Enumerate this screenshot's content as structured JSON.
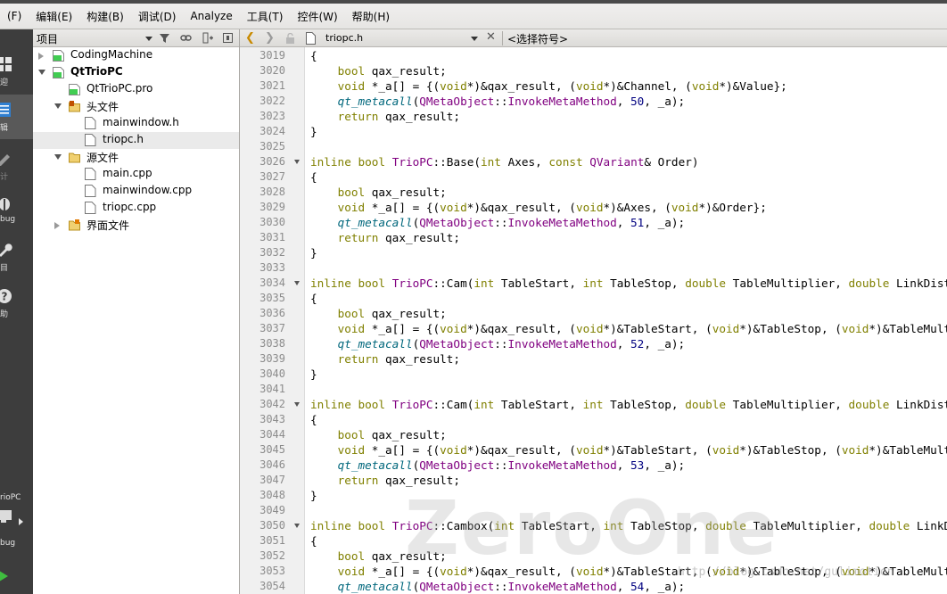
{
  "menu": [
    "(F)",
    "编辑(E)",
    "构建(B)",
    "调试(D)",
    "Analyze",
    "工具(T)",
    "控件(W)",
    "帮助(H)"
  ],
  "modes": [
    {
      "label": "迎",
      "icon": "grid-icon"
    },
    {
      "label": "辑",
      "icon": "edit-icon"
    },
    {
      "label": "计",
      "icon": "pencil-icon"
    },
    {
      "label": "bug",
      "icon": "debug-icon"
    },
    {
      "label": "目",
      "icon": "wrench-icon"
    },
    {
      "label": "助",
      "icon": "help-icon"
    }
  ],
  "kit": {
    "label": "rioPC",
    "sublabel": "bug"
  },
  "project_panel": {
    "title": "项目"
  },
  "tree": [
    {
      "label": "CodingMachine",
      "bold": false,
      "level": 0,
      "arrow": "right",
      "icon": "qt-project-icon",
      "selected": false
    },
    {
      "label": "QtTrioPC",
      "bold": true,
      "level": 0,
      "arrow": "down",
      "icon": "qt-project-icon",
      "selected": false
    },
    {
      "label": "QtTrioPC.pro",
      "bold": false,
      "level": 1,
      "arrow": "none",
      "icon": "qt-project-icon",
      "selected": false
    },
    {
      "label": "头文件",
      "bold": false,
      "level": 1,
      "arrow": "down",
      "icon": "header-folder-icon",
      "selected": false
    },
    {
      "label": "mainwindow.h",
      "bold": false,
      "level": 2,
      "arrow": "none",
      "icon": "file-icon",
      "selected": false
    },
    {
      "label": "triopc.h",
      "bold": false,
      "level": 2,
      "arrow": "none",
      "icon": "file-icon",
      "selected": true
    },
    {
      "label": "源文件",
      "bold": false,
      "level": 1,
      "arrow": "down",
      "icon": "source-folder-icon",
      "selected": false
    },
    {
      "label": "main.cpp",
      "bold": false,
      "level": 2,
      "arrow": "none",
      "icon": "file-icon",
      "selected": false
    },
    {
      "label": "mainwindow.cpp",
      "bold": false,
      "level": 2,
      "arrow": "none",
      "icon": "file-icon",
      "selected": false
    },
    {
      "label": "triopc.cpp",
      "bold": false,
      "level": 2,
      "arrow": "none",
      "icon": "file-icon",
      "selected": false
    },
    {
      "label": "界面文件",
      "bold": false,
      "level": 1,
      "arrow": "right",
      "icon": "form-folder-icon",
      "selected": false
    }
  ],
  "editor": {
    "file_name": "triopc.h",
    "symbol_placeholder": "<选择符号>",
    "lines": [
      {
        "n": "3019",
        "fold": false,
        "tokens": [
          [
            "p",
            "{"
          ]
        ]
      },
      {
        "n": "3020",
        "fold": false,
        "tokens": [
          [
            "p",
            "    "
          ],
          [
            "kw",
            "bool"
          ],
          [
            "p",
            " qax_result;"
          ]
        ]
      },
      {
        "n": "3021",
        "fold": false,
        "tokens": [
          [
            "p",
            "    "
          ],
          [
            "kw",
            "void"
          ],
          [
            "p",
            " *_a[] = {("
          ],
          [
            "kw",
            "void"
          ],
          [
            "p",
            "*)&qax_result, ("
          ],
          [
            "kw",
            "void"
          ],
          [
            "p",
            "*)&Channel, ("
          ],
          [
            "kw",
            "void"
          ],
          [
            "p",
            "*)&Value};"
          ]
        ]
      },
      {
        "n": "3022",
        "fold": false,
        "tokens": [
          [
            "p",
            "    "
          ],
          [
            "fn",
            "qt_metacall"
          ],
          [
            "p",
            "("
          ],
          [
            "ty",
            "QMetaObject"
          ],
          [
            "p",
            "::"
          ],
          [
            "ty",
            "InvokeMetaMethod"
          ],
          [
            "p",
            ", "
          ],
          [
            "num",
            "50"
          ],
          [
            "p",
            ", _a);"
          ]
        ]
      },
      {
        "n": "3023",
        "fold": false,
        "tokens": [
          [
            "p",
            "    "
          ],
          [
            "kw",
            "return"
          ],
          [
            "p",
            " qax_result;"
          ]
        ]
      },
      {
        "n": "3024",
        "fold": false,
        "tokens": [
          [
            "p",
            "}"
          ]
        ]
      },
      {
        "n": "3025",
        "fold": false,
        "tokens": []
      },
      {
        "n": "3026",
        "fold": true,
        "tokens": [
          [
            "kw",
            "inline"
          ],
          [
            "p",
            " "
          ],
          [
            "kw",
            "bool"
          ],
          [
            "p",
            " "
          ],
          [
            "ty",
            "TrioPC"
          ],
          [
            "p",
            "::Base("
          ],
          [
            "kw",
            "int"
          ],
          [
            "p",
            " Axes, "
          ],
          [
            "kw",
            "const"
          ],
          [
            "p",
            " "
          ],
          [
            "ty",
            "QVariant"
          ],
          [
            "p",
            "& Order)"
          ]
        ]
      },
      {
        "n": "3027",
        "fold": false,
        "tokens": [
          [
            "p",
            "{"
          ]
        ]
      },
      {
        "n": "3028",
        "fold": false,
        "tokens": [
          [
            "p",
            "    "
          ],
          [
            "kw",
            "bool"
          ],
          [
            "p",
            " qax_result;"
          ]
        ]
      },
      {
        "n": "3029",
        "fold": false,
        "tokens": [
          [
            "p",
            "    "
          ],
          [
            "kw",
            "void"
          ],
          [
            "p",
            " *_a[] = {("
          ],
          [
            "kw",
            "void"
          ],
          [
            "p",
            "*)&qax_result, ("
          ],
          [
            "kw",
            "void"
          ],
          [
            "p",
            "*)&Axes, ("
          ],
          [
            "kw",
            "void"
          ],
          [
            "p",
            "*)&Order};"
          ]
        ]
      },
      {
        "n": "3030",
        "fold": false,
        "tokens": [
          [
            "p",
            "    "
          ],
          [
            "fn",
            "qt_metacall"
          ],
          [
            "p",
            "("
          ],
          [
            "ty",
            "QMetaObject"
          ],
          [
            "p",
            "::"
          ],
          [
            "ty",
            "InvokeMetaMethod"
          ],
          [
            "p",
            ", "
          ],
          [
            "num",
            "51"
          ],
          [
            "p",
            ", _a);"
          ]
        ]
      },
      {
        "n": "3031",
        "fold": false,
        "tokens": [
          [
            "p",
            "    "
          ],
          [
            "kw",
            "return"
          ],
          [
            "p",
            " qax_result;"
          ]
        ]
      },
      {
        "n": "3032",
        "fold": false,
        "tokens": [
          [
            "p",
            "}"
          ]
        ]
      },
      {
        "n": "3033",
        "fold": false,
        "tokens": []
      },
      {
        "n": "3034",
        "fold": true,
        "tokens": [
          [
            "kw",
            "inline"
          ],
          [
            "p",
            " "
          ],
          [
            "kw",
            "bool"
          ],
          [
            "p",
            " "
          ],
          [
            "ty",
            "TrioPC"
          ],
          [
            "p",
            "::Cam("
          ],
          [
            "kw",
            "int"
          ],
          [
            "p",
            " TableStart, "
          ],
          [
            "kw",
            "int"
          ],
          [
            "p",
            " TableStop, "
          ],
          [
            "kw",
            "double"
          ],
          [
            "p",
            " TableMultiplier, "
          ],
          [
            "kw",
            "double"
          ],
          [
            "p",
            " LinkDistance)"
          ]
        ]
      },
      {
        "n": "3035",
        "fold": false,
        "tokens": [
          [
            "p",
            "{"
          ]
        ]
      },
      {
        "n": "3036",
        "fold": false,
        "tokens": [
          [
            "p",
            "    "
          ],
          [
            "kw",
            "bool"
          ],
          [
            "p",
            " qax_result;"
          ]
        ]
      },
      {
        "n": "3037",
        "fold": false,
        "tokens": [
          [
            "p",
            "    "
          ],
          [
            "kw",
            "void"
          ],
          [
            "p",
            " *_a[] = {("
          ],
          [
            "kw",
            "void"
          ],
          [
            "p",
            "*)&qax_result, ("
          ],
          [
            "kw",
            "void"
          ],
          [
            "p",
            "*)&TableStart, ("
          ],
          [
            "kw",
            "void"
          ],
          [
            "p",
            "*)&TableStop, ("
          ],
          [
            "kw",
            "void"
          ],
          [
            "p",
            "*)&TableMultiplier};"
          ]
        ]
      },
      {
        "n": "3038",
        "fold": false,
        "tokens": [
          [
            "p",
            "    "
          ],
          [
            "fn",
            "qt_metacall"
          ],
          [
            "p",
            "("
          ],
          [
            "ty",
            "QMetaObject"
          ],
          [
            "p",
            "::"
          ],
          [
            "ty",
            "InvokeMetaMethod"
          ],
          [
            "p",
            ", "
          ],
          [
            "num",
            "52"
          ],
          [
            "p",
            ", _a);"
          ]
        ]
      },
      {
        "n": "3039",
        "fold": false,
        "tokens": [
          [
            "p",
            "    "
          ],
          [
            "kw",
            "return"
          ],
          [
            "p",
            " qax_result;"
          ]
        ]
      },
      {
        "n": "3040",
        "fold": false,
        "tokens": [
          [
            "p",
            "}"
          ]
        ]
      },
      {
        "n": "3041",
        "fold": false,
        "tokens": []
      },
      {
        "n": "3042",
        "fold": true,
        "tokens": [
          [
            "kw",
            "inline"
          ],
          [
            "p",
            " "
          ],
          [
            "kw",
            "bool"
          ],
          [
            "p",
            " "
          ],
          [
            "ty",
            "TrioPC"
          ],
          [
            "p",
            "::Cam("
          ],
          [
            "kw",
            "int"
          ],
          [
            "p",
            " TableStart, "
          ],
          [
            "kw",
            "int"
          ],
          [
            "p",
            " TableStop, "
          ],
          [
            "kw",
            "double"
          ],
          [
            "p",
            " TableMultiplier, "
          ],
          [
            "kw",
            "double"
          ],
          [
            "p",
            " LinkDistance)"
          ]
        ]
      },
      {
        "n": "3043",
        "fold": false,
        "tokens": [
          [
            "p",
            "{"
          ]
        ]
      },
      {
        "n": "3044",
        "fold": false,
        "tokens": [
          [
            "p",
            "    "
          ],
          [
            "kw",
            "bool"
          ],
          [
            "p",
            " qax_result;"
          ]
        ]
      },
      {
        "n": "3045",
        "fold": false,
        "tokens": [
          [
            "p",
            "    "
          ],
          [
            "kw",
            "void"
          ],
          [
            "p",
            " *_a[] = {("
          ],
          [
            "kw",
            "void"
          ],
          [
            "p",
            "*)&qax_result, ("
          ],
          [
            "kw",
            "void"
          ],
          [
            "p",
            "*)&TableStart, ("
          ],
          [
            "kw",
            "void"
          ],
          [
            "p",
            "*)&TableStop, ("
          ],
          [
            "kw",
            "void"
          ],
          [
            "p",
            "*)&TableMultiplier};"
          ]
        ]
      },
      {
        "n": "3046",
        "fold": false,
        "tokens": [
          [
            "p",
            "    "
          ],
          [
            "fn",
            "qt_metacall"
          ],
          [
            "p",
            "("
          ],
          [
            "ty",
            "QMetaObject"
          ],
          [
            "p",
            "::"
          ],
          [
            "ty",
            "InvokeMetaMethod"
          ],
          [
            "p",
            ", "
          ],
          [
            "num",
            "53"
          ],
          [
            "p",
            ", _a);"
          ]
        ]
      },
      {
        "n": "3047",
        "fold": false,
        "tokens": [
          [
            "p",
            "    "
          ],
          [
            "kw",
            "return"
          ],
          [
            "p",
            " qax_result;"
          ]
        ]
      },
      {
        "n": "3048",
        "fold": false,
        "tokens": [
          [
            "p",
            "}"
          ]
        ]
      },
      {
        "n": "3049",
        "fold": false,
        "tokens": []
      },
      {
        "n": "3050",
        "fold": true,
        "tokens": [
          [
            "kw",
            "inline"
          ],
          [
            "p",
            " "
          ],
          [
            "kw",
            "bool"
          ],
          [
            "p",
            " "
          ],
          [
            "ty",
            "TrioPC"
          ],
          [
            "p",
            "::Cambox("
          ],
          [
            "kw",
            "int"
          ],
          [
            "p",
            " TableStart, "
          ],
          [
            "kw",
            "int"
          ],
          [
            "p",
            " TableStop, "
          ],
          [
            "kw",
            "double"
          ],
          [
            "p",
            " TableMultiplier, "
          ],
          [
            "kw",
            "double"
          ],
          [
            "p",
            " LinkDistance)"
          ]
        ]
      },
      {
        "n": "3051",
        "fold": false,
        "tokens": [
          [
            "p",
            "{"
          ]
        ]
      },
      {
        "n": "3052",
        "fold": false,
        "tokens": [
          [
            "p",
            "    "
          ],
          [
            "kw",
            "bool"
          ],
          [
            "p",
            " qax_result;"
          ]
        ]
      },
      {
        "n": "3053",
        "fold": false,
        "tokens": [
          [
            "p",
            "    "
          ],
          [
            "kw",
            "void"
          ],
          [
            "p",
            " *_a[] = {("
          ],
          [
            "kw",
            "void"
          ],
          [
            "p",
            "*)&qax_result, ("
          ],
          [
            "kw",
            "void"
          ],
          [
            "p",
            "*)&TableStart, ("
          ],
          [
            "kw",
            "void"
          ],
          [
            "p",
            "*)&TableStop, ("
          ],
          [
            "kw",
            "void"
          ],
          [
            "p",
            "*)&TableMultiplier};"
          ]
        ]
      },
      {
        "n": "3054",
        "fold": false,
        "tokens": [
          [
            "p",
            "    "
          ],
          [
            "fn",
            "qt_metacall"
          ],
          [
            "p",
            "("
          ],
          [
            "ty",
            "QMetaObject"
          ],
          [
            "p",
            "::"
          ],
          [
            "ty",
            "InvokeMetaMethod"
          ],
          [
            "p",
            ", "
          ],
          [
            "num",
            "54"
          ],
          [
            "p",
            ", _a);"
          ]
        ]
      }
    ]
  },
  "watermark": {
    "logo": "ZeroOne",
    "url": "http://blog.csdn.net/gulimotion"
  },
  "colors": {
    "keyword": "#808000",
    "type": "#800080",
    "number": "#000080",
    "function": "#00677c",
    "mode_bar": "#3d3d3d",
    "run": "#3fbd3f"
  }
}
